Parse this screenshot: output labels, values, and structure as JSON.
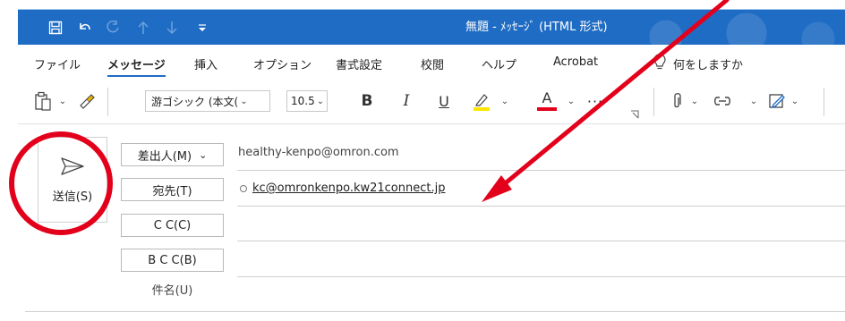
{
  "window": {
    "title": "無題 - ﾒｯｾｰｼﾞ (HTML 形式)"
  },
  "menu": {
    "tabs": [
      {
        "label": "ファイル"
      },
      {
        "label": "メッセージ"
      },
      {
        "label": "挿入"
      },
      {
        "label": "オプション"
      },
      {
        "label": "書式設定"
      },
      {
        "label": "校閲"
      },
      {
        "label": "ヘルプ"
      },
      {
        "label": "Acrobat"
      }
    ],
    "tell_me": "何をしますか"
  },
  "ribbon": {
    "font_name": "游ゴシック (本文(",
    "font_size": "10.5",
    "bold": "B",
    "italic": "I",
    "underline": "U",
    "font_color_label": "A",
    "more": "···",
    "highlight_color": "#ffe600",
    "font_color": "#e3001b"
  },
  "compose": {
    "send_label": "送信(S)",
    "from_label": "差出人(M)",
    "from_value": "healthy-kenpo@omron.com",
    "to_label": "宛先(T)",
    "to_value": "kc@omronkenpo.kw21connect.jp",
    "cc_label": "C C(C)",
    "bcc_label": "B C C(B)",
    "subject_label": "件名(U)"
  },
  "annotation": {
    "color": "#e3001b"
  },
  "theme": {
    "titlebar_color": "#1f6cc4"
  }
}
